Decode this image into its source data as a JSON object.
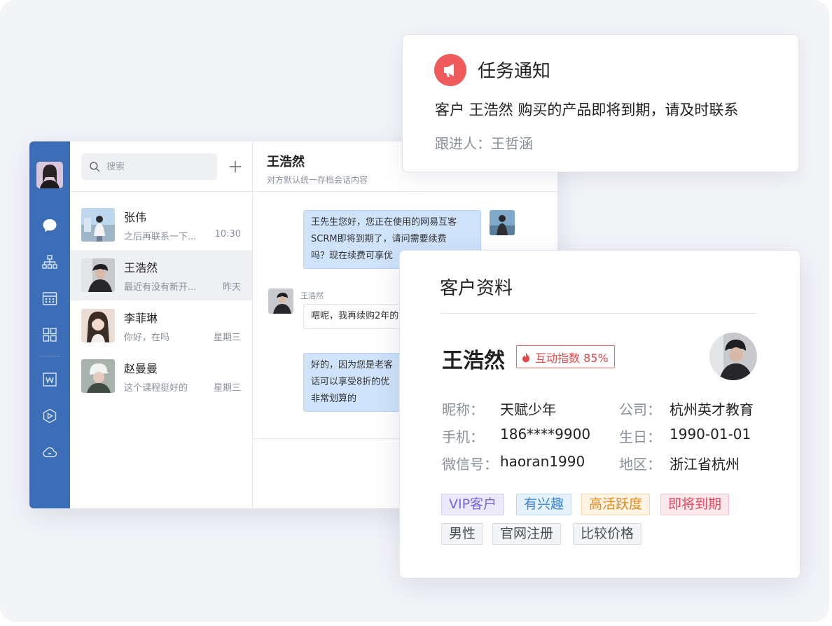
{
  "sidebar": {
    "icons": [
      "chat-bubble-icon",
      "org-chart-icon",
      "calendar-icon",
      "apps-grid-icon",
      "document-w-icon",
      "cube-icon",
      "cloud-icon"
    ]
  },
  "search": {
    "placeholder": "搜索"
  },
  "conversations": [
    {
      "name": "张伟",
      "last": "之后再联系一下...",
      "time": "10:30",
      "active": false
    },
    {
      "name": "王浩然",
      "last": "最近有没有新开...",
      "time": "昨天",
      "active": true
    },
    {
      "name": "李菲琳",
      "last": "你好，在吗",
      "time": "星期三",
      "active": false
    },
    {
      "name": "赵曼曼",
      "last": "这个课程挺好的",
      "time": "星期三",
      "active": false
    }
  ],
  "chat": {
    "title": "王浩然",
    "subtitle": "对方默认统一存档会话内容",
    "messages": [
      {
        "dir": "out",
        "lines": [
          "王先生您好，您正在使用的网易互客",
          "SCRM即将到期了，请问需要续费",
          "吗？现在续费可享优"
        ]
      },
      {
        "dir": "in",
        "sender": "王浩然",
        "lines": [
          "嗯呢，我再续购2年的"
        ]
      },
      {
        "dir": "out",
        "lines": [
          "好的，因为您是老客",
          "话可以享受8折的优",
          "非常划算的"
        ]
      }
    ]
  },
  "notice": {
    "title": "任务通知",
    "body": "客户 王浩然 购买的产品即将到期，请及时联系",
    "follow": "跟进人：王哲涵",
    "accent": "#ef5a5a"
  },
  "profile": {
    "title": "客户资料",
    "name": "王浩然",
    "score_label": "互动指数 85%",
    "fields": [
      {
        "k": "昵称：",
        "v": "天赋少年"
      },
      {
        "k": "公司：",
        "v": "杭州英才教育"
      },
      {
        "k": "手机：",
        "v": "186****9900"
      },
      {
        "k": "生日：",
        "v": "1990-01-01"
      },
      {
        "k": "微信号：",
        "v": "haoran1990"
      },
      {
        "k": "地区：",
        "v": "浙江省杭州"
      }
    ],
    "tags": [
      "VIP客户",
      "有兴趣",
      "高活跃度",
      "即将到期",
      "男性",
      "官网注册",
      "比较价格"
    ]
  }
}
